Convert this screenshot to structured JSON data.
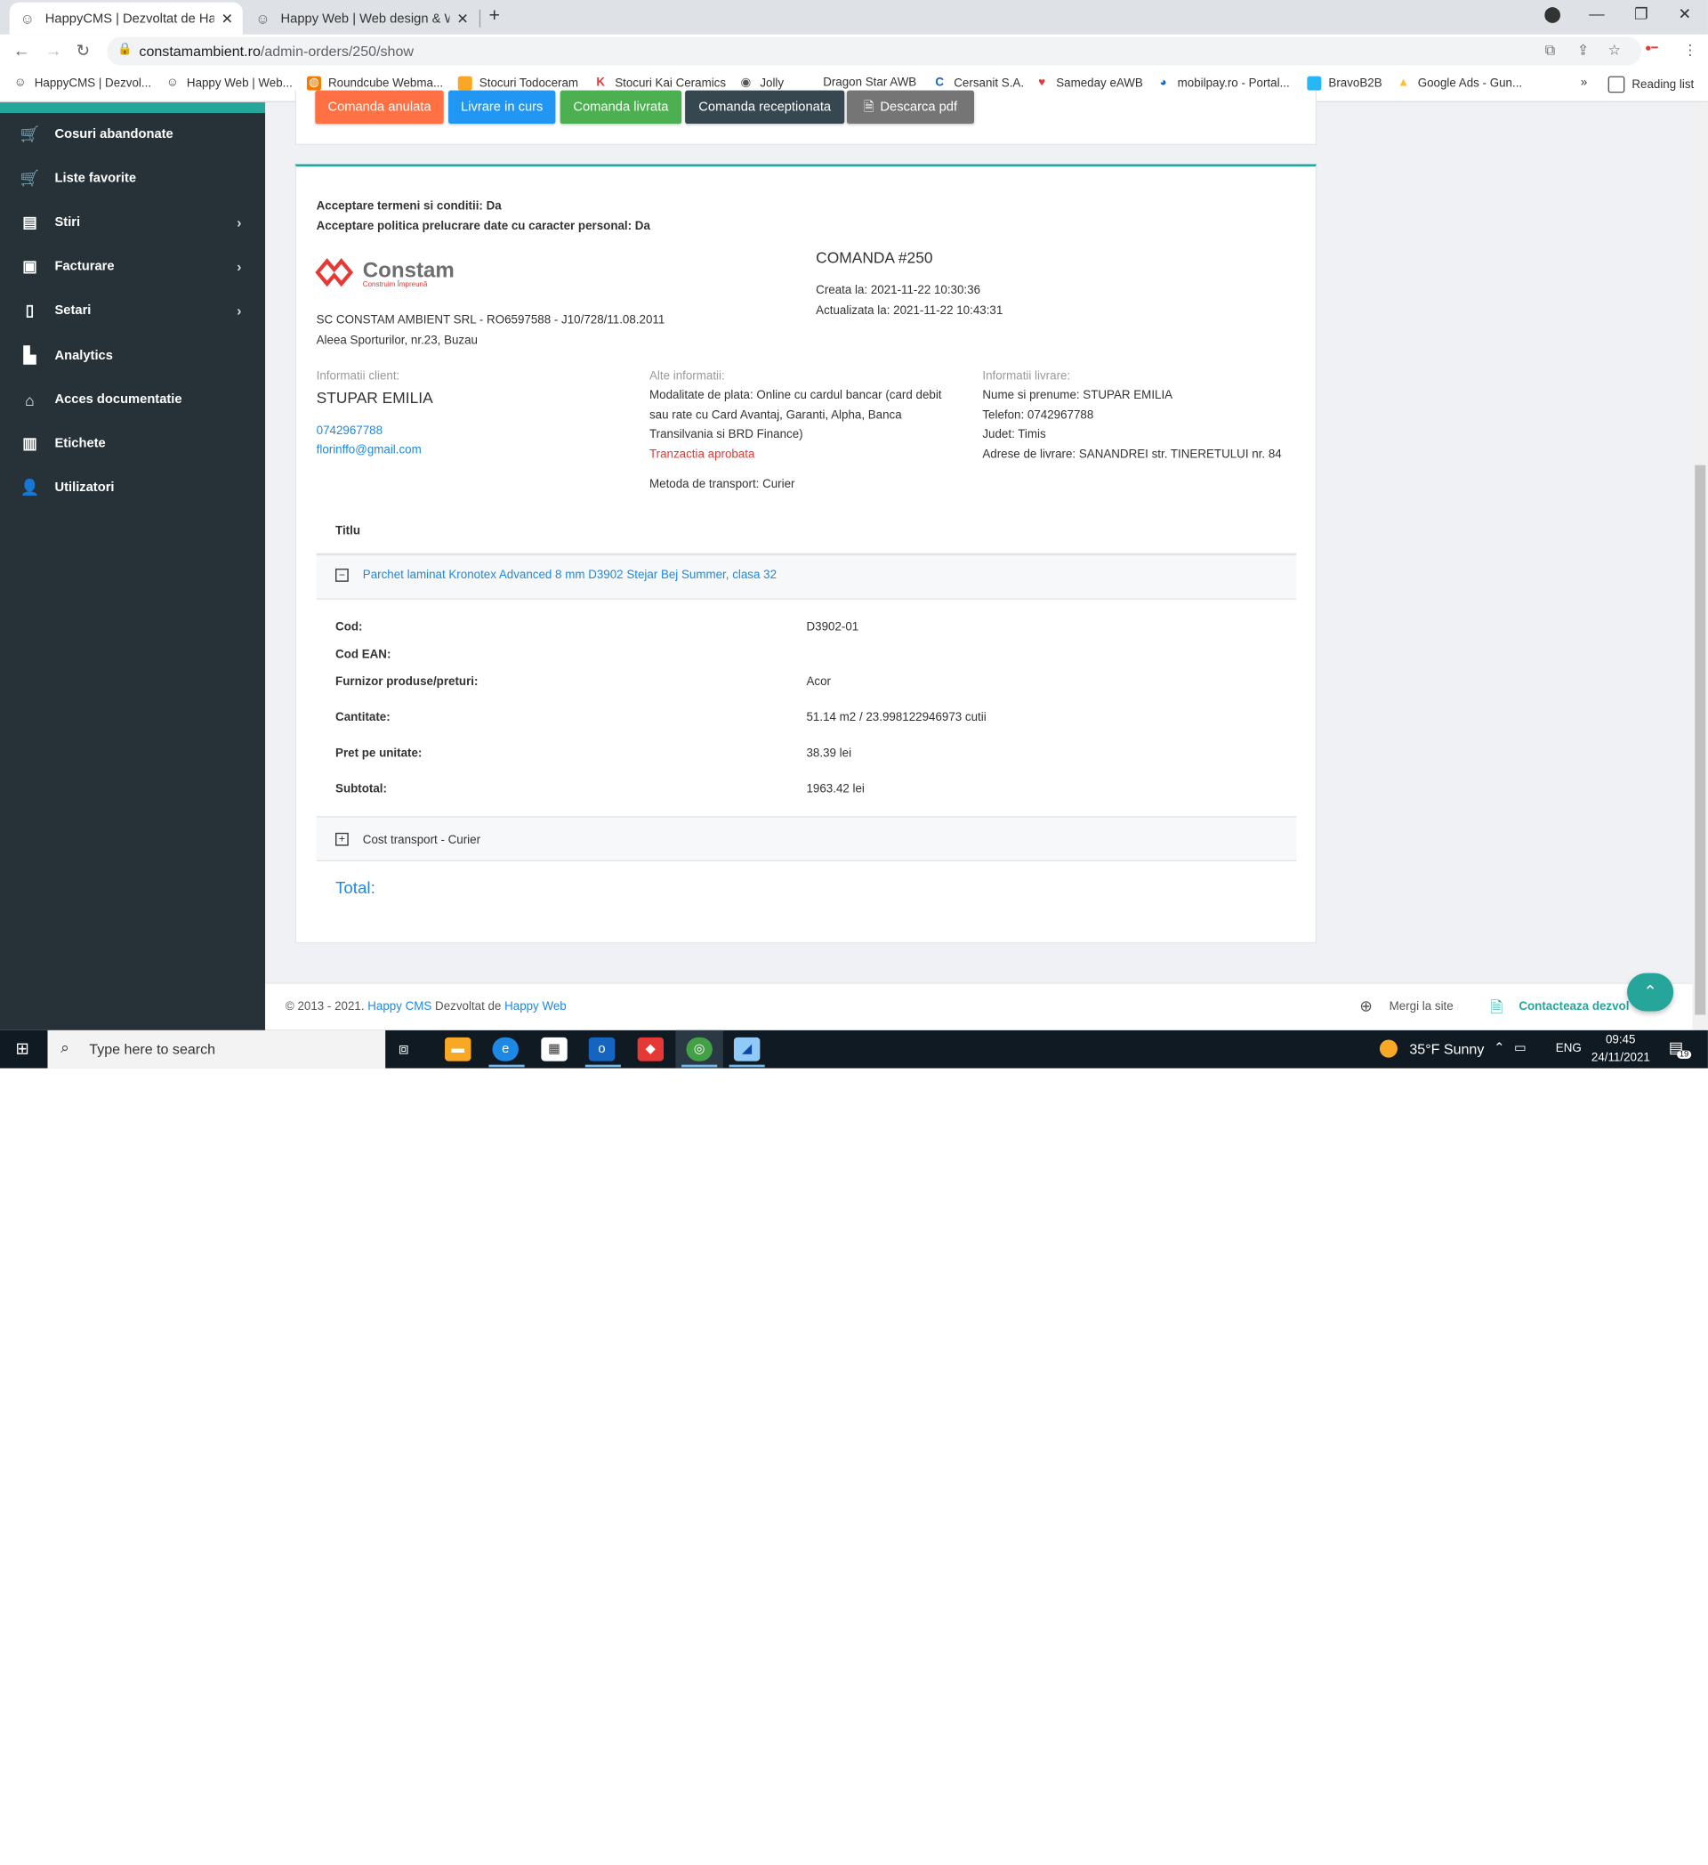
{
  "browser": {
    "tabs": [
      {
        "title": "HappyCMS | Dezvoltat de Happy",
        "active": true
      },
      {
        "title": "Happy Web | Web design & Web",
        "active": false
      }
    ],
    "url_host": "constamambient.ro",
    "url_path": "/admin-orders/250/show",
    "bookmarks": [
      "HappyCMS | Dezvol...",
      "Happy Web | Web...",
      "Roundcube Webma...",
      "Stocuri Todoceram",
      "Stocuri Kai Ceramics",
      "Jolly",
      "Dragon Star AWB",
      "Cersanit S.A.",
      "Sameday eAWB",
      "mobilpay.ro - Portal...",
      "BravoB2B",
      "Google Ads - Gun..."
    ],
    "bookmarks_more": "»",
    "reading_list": "Reading list"
  },
  "sidebar": {
    "items": [
      {
        "label": "Cosuri abandonate",
        "icon": "cart-icon",
        "chevron": false
      },
      {
        "label": "Liste favorite",
        "icon": "cart-icon",
        "chevron": false
      },
      {
        "label": "Stiri",
        "icon": "news-icon",
        "chevron": true
      },
      {
        "label": "Facturare",
        "icon": "money-icon",
        "chevron": true
      },
      {
        "label": "Setari",
        "icon": "clipboard-icon",
        "chevron": true
      },
      {
        "label": "Analytics",
        "icon": "chart-icon",
        "chevron": false
      },
      {
        "label": "Acces documentatie",
        "icon": "home-icon",
        "chevron": false
      },
      {
        "label": "Etichete",
        "icon": "book-icon",
        "chevron": false
      },
      {
        "label": "Utilizatori",
        "icon": "user-icon",
        "chevron": false
      }
    ]
  },
  "status_buttons": [
    {
      "label": "Comanda anulata",
      "color": "#ff7043"
    },
    {
      "label": "Livrare in curs",
      "color": "#2196f3"
    },
    {
      "label": "Comanda livrata",
      "color": "#4caf50"
    },
    {
      "label": "Comanda receptionata",
      "color": "#37474f"
    },
    {
      "label": "Descarca pdf",
      "color": "#757575"
    }
  ],
  "order": {
    "terms": "Acceptare termeni si conditii: Da",
    "privacy": "Acceptare politica prelucrare date cu caracter personal: Da",
    "logo_name": "Constam",
    "logo_tagline": "Construim Împreună",
    "company": "SC CONSTAM AMBIENT SRL - RO6597588 - J10/728/11.08.2011",
    "address": "Aleea Sporturilor, nr.23, Buzau",
    "title": "COMANDA #250",
    "created": "Creata la: 2021-11-22 10:30:36",
    "updated": "Actualizata la: 2021-11-22 10:43:31",
    "client": {
      "heading": "Informatii client:",
      "name": "STUPAR EMILIA",
      "phone": "0742967788",
      "email": "florinffo@gmail.com"
    },
    "other": {
      "heading": "Alte informatii:",
      "payment_lines": [
        "Modalitate de plata: Online cu cardul bancar (card debit",
        "sau rate cu Card Avantaj, Garanti, Alpha, Banca",
        "Transilvania si BRD Finance)"
      ],
      "transaction": "Tranzactia aprobata",
      "transport": "Metoda de transport: Curier"
    },
    "delivery": {
      "heading": "Informatii livrare:",
      "name": "Nume si prenume: STUPAR EMILIA",
      "phone": "Telefon: 0742967788",
      "county": "Judet: Timis",
      "address": "Adrese de livrare: SANANDREI str. TINERETULUI nr. 84"
    },
    "table_header": "Titlu",
    "product": {
      "title": "Parchet laminat Kronotex Advanced 8 mm D3902 Stejar Bej Summer, clasa 32",
      "details": [
        {
          "label": "Cod:",
          "value": "D3902-01"
        },
        {
          "label": "Cod EAN:",
          "value": ""
        },
        {
          "label": "Furnizor produse/preturi:",
          "value": "Acor"
        },
        {
          "label": "Cantitate:",
          "value": "51.14 m2 / 23.998122946973 cutii"
        },
        {
          "label": "Pret pe unitate:",
          "value": "38.39 lei"
        },
        {
          "label": "Subtotal:",
          "value": "1963.42 lei"
        }
      ]
    },
    "transport_row": "Cost transport - Curier",
    "total_label": "Total:"
  },
  "footer": {
    "copyright": "© 2013 - 2021.",
    "cms_link": "Happy CMS",
    "dev_text": "Dezvoltat de",
    "dev_link": "Happy Web",
    "goto_site": "Mergi la site",
    "contact": "Contacteaza dezvol"
  },
  "taskbar": {
    "search_placeholder": "Type here to search",
    "weather": "35°F  Sunny",
    "lang": "ENG",
    "time": "09:45",
    "date": "24/11/2021",
    "notif_count": "19"
  }
}
